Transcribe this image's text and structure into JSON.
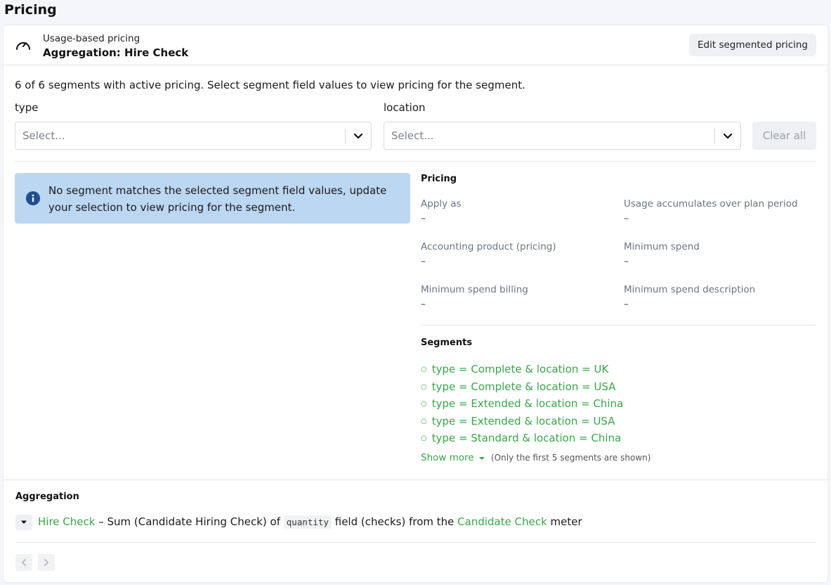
{
  "page": {
    "title": "Pricing"
  },
  "header": {
    "subtitle": "Usage-based pricing",
    "title": "Aggregation: Hire Check",
    "edit_label": "Edit segmented pricing",
    "icon": "gauge-icon"
  },
  "summary": "6 of 6 segments with active pricing. Select segment field values to view pricing for the segment.",
  "filters": {
    "type": {
      "label": "type",
      "placeholder": "Select..."
    },
    "location": {
      "label": "location",
      "placeholder": "Select..."
    },
    "clear_label": "Clear all"
  },
  "info": {
    "text": "No segment matches the selected segment field values, update your selection to view pricing for the segment."
  },
  "pricing": {
    "heading": "Pricing",
    "apply_as": {
      "label": "Apply as",
      "value": "–"
    },
    "usage_accumulates": {
      "label": "Usage accumulates over plan period",
      "value": "–"
    },
    "accounting_product": {
      "label": "Accounting product (pricing)",
      "value": "–"
    },
    "minimum_spend": {
      "label": "Minimum spend",
      "value": "–"
    },
    "minimum_spend_billing": {
      "label": "Minimum spend billing",
      "value": "–"
    },
    "minimum_spend_description": {
      "label": "Minimum spend description",
      "value": "–"
    }
  },
  "segments": {
    "heading": "Segments",
    "items": [
      "type = Complete & location = UK",
      "type = Complete & location = USA",
      "type = Extended & location = China",
      "type = Extended & location = USA",
      "type = Standard & location = China"
    ],
    "show_more_label": "Show more",
    "show_more_note": "(Only the first 5 segments are shown)"
  },
  "aggregation": {
    "heading": "Aggregation",
    "name": "Hire Check",
    "text_1": " – Sum (Candidate Hiring Check) of ",
    "field": "quantity",
    "text_2": " field (checks) from the ",
    "meter": "Candidate Check",
    "text_3": " meter"
  },
  "colors": {
    "accent_green": "#3aa54a",
    "info_bg": "#bcd7f1",
    "info_icon": "#1f4f8f"
  }
}
